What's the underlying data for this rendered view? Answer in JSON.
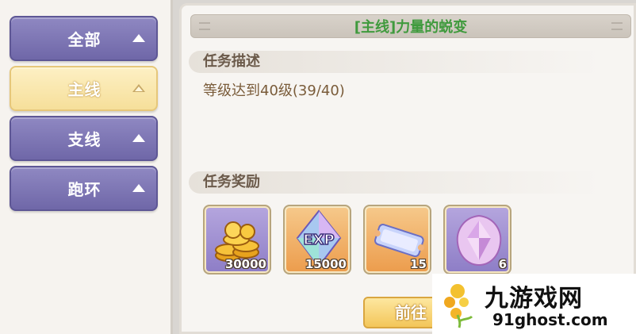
{
  "categories": [
    {
      "label": "全部",
      "active": false
    },
    {
      "label": "主线",
      "active": true
    },
    {
      "label": "支线",
      "active": false
    },
    {
      "label": "跑环",
      "active": false
    }
  ],
  "quest": {
    "title": "[主线]力量的蜕变",
    "description_header": "任务描述",
    "description": "等级达到40级(39/40)",
    "rewards_header": "任务奖励"
  },
  "rewards": [
    {
      "icon": "gold-coins-icon",
      "count": "30000"
    },
    {
      "icon": "exp-crystal-icon",
      "count": "15000"
    },
    {
      "icon": "blue-ticket-icon",
      "count": "15"
    },
    {
      "icon": "pink-gem-icon",
      "count": "6"
    }
  ],
  "actions": {
    "go_label": "前往"
  },
  "watermark": {
    "title": "九游戏网",
    "url": "91ghost.com"
  },
  "colors": {
    "category_button": "#7d76b6",
    "category_active": "#f9e7ac",
    "title_text": "#3f9a3d",
    "description_text": "#7a5c3a"
  }
}
